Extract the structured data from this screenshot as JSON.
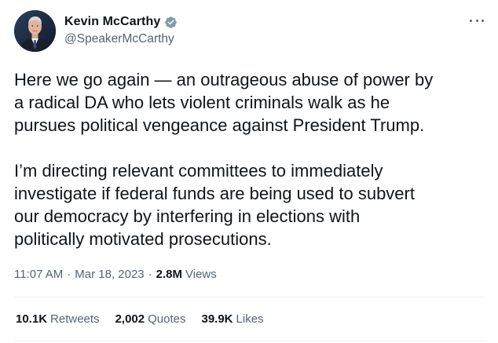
{
  "author": {
    "display_name": "Kevin McCarthy",
    "handle": "@SpeakerMcCarthy",
    "verified": true,
    "verified_color": "#829aab"
  },
  "tweet": {
    "paragraphs": [
      "Here we go again — an outrageous abuse of power by\na radical DA who lets violent criminals walk as he\npursues political vengeance against President Trump.",
      "I’m directing relevant committees to immediately\ninvestigate if federal funds are being used to subvert\nour democracy by interfering in elections with\npolitically motivated prosecutions."
    ]
  },
  "meta": {
    "time": "11:07 AM",
    "separator": "·",
    "date": "Mar 18, 2023",
    "views_count": "2.8M",
    "views_label": "Views"
  },
  "stats": {
    "retweets_count": "10.1K",
    "retweets_label": "Retweets",
    "quotes_count": "2,002",
    "quotes_label": "Quotes",
    "likes_count": "39.9K",
    "likes_label": "Likes"
  },
  "colors": {
    "text": "#0f1419",
    "secondary": "#536471",
    "divider": "#eff3f4"
  }
}
